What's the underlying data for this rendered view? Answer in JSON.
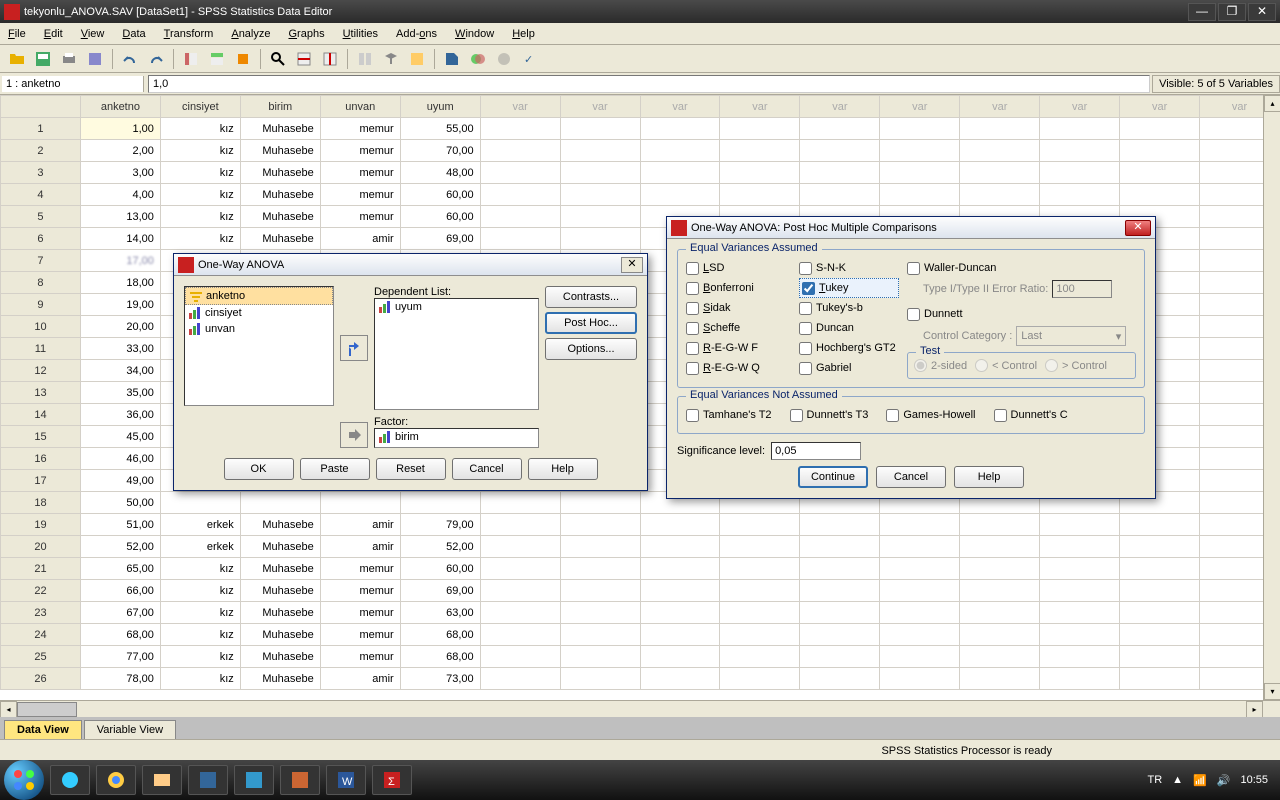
{
  "window": {
    "title": "tekyonlu_ANOVA.SAV [DataSet1] - SPSS Statistics Data Editor"
  },
  "menus": [
    "File",
    "Edit",
    "View",
    "Data",
    "Transform",
    "Analyze",
    "Graphs",
    "Utilities",
    "Add-ons",
    "Window",
    "Help"
  ],
  "cellbar": {
    "ref": "1 : anketno",
    "val": "1,0",
    "visible": "Visible: 5 of 5 Variables"
  },
  "columns": [
    "anketno",
    "cinsiyet",
    "birim",
    "unvan",
    "uyum"
  ],
  "varcol": "var",
  "rows": [
    {
      "n": 1,
      "c": [
        "1,00",
        "kız",
        "Muhasebe",
        "memur",
        "55,00"
      ]
    },
    {
      "n": 2,
      "c": [
        "2,00",
        "kız",
        "Muhasebe",
        "memur",
        "70,00"
      ]
    },
    {
      "n": 3,
      "c": [
        "3,00",
        "kız",
        "Muhasebe",
        "memur",
        "48,00"
      ]
    },
    {
      "n": 4,
      "c": [
        "4,00",
        "kız",
        "Muhasebe",
        "memur",
        "60,00"
      ]
    },
    {
      "n": 5,
      "c": [
        "13,00",
        "kız",
        "Muhasebe",
        "memur",
        "60,00"
      ]
    },
    {
      "n": 6,
      "c": [
        "14,00",
        "kız",
        "Muhasebe",
        "amir",
        "69,00"
      ]
    },
    {
      "n": 7,
      "c": [
        "17,00",
        "",
        "",
        "",
        ""
      ],
      "blur": true
    },
    {
      "n": 8,
      "c": [
        "18,00",
        "",
        "",
        "",
        ""
      ]
    },
    {
      "n": 9,
      "c": [
        "19,00",
        "",
        "",
        "",
        ""
      ]
    },
    {
      "n": 10,
      "c": [
        "20,00",
        "",
        "",
        "",
        ""
      ]
    },
    {
      "n": 11,
      "c": [
        "33,00",
        "",
        "",
        "",
        ""
      ]
    },
    {
      "n": 12,
      "c": [
        "34,00",
        "",
        "",
        "",
        ""
      ]
    },
    {
      "n": 13,
      "c": [
        "35,00",
        "",
        "",
        "",
        ""
      ]
    },
    {
      "n": 14,
      "c": [
        "36,00",
        "",
        "",
        "",
        ""
      ]
    },
    {
      "n": 15,
      "c": [
        "45,00",
        "",
        "",
        "",
        ""
      ]
    },
    {
      "n": 16,
      "c": [
        "46,00",
        "",
        "",
        "",
        ""
      ]
    },
    {
      "n": 17,
      "c": [
        "49,00",
        "",
        "",
        "",
        ""
      ]
    },
    {
      "n": 18,
      "c": [
        "50,00",
        "",
        "",
        "",
        ""
      ]
    },
    {
      "n": 19,
      "c": [
        "51,00",
        "erkek",
        "Muhasebe",
        "amir",
        "79,00"
      ]
    },
    {
      "n": 20,
      "c": [
        "52,00",
        "erkek",
        "Muhasebe",
        "amir",
        "52,00"
      ]
    },
    {
      "n": 21,
      "c": [
        "65,00",
        "kız",
        "Muhasebe",
        "memur",
        "60,00"
      ]
    },
    {
      "n": 22,
      "c": [
        "66,00",
        "kız",
        "Muhasebe",
        "memur",
        "69,00"
      ]
    },
    {
      "n": 23,
      "c": [
        "67,00",
        "kız",
        "Muhasebe",
        "memur",
        "63,00"
      ]
    },
    {
      "n": 24,
      "c": [
        "68,00",
        "kız",
        "Muhasebe",
        "memur",
        "68,00"
      ]
    },
    {
      "n": 25,
      "c": [
        "77,00",
        "kız",
        "Muhasebe",
        "memur",
        "68,00"
      ]
    },
    {
      "n": 26,
      "c": [
        "78,00",
        "kız",
        "Muhasebe",
        "amir",
        "73,00"
      ]
    }
  ],
  "tabs": {
    "data": "Data View",
    "var": "Variable View"
  },
  "status": "SPSS Statistics Processor is ready",
  "dialog1": {
    "title": "One-Way ANOVA",
    "source": [
      "anketno",
      "cinsiyet",
      "unvan"
    ],
    "dep_label": "Dependent List:",
    "dep": [
      "uyum"
    ],
    "factor_label": "Factor:",
    "factor": "birim",
    "btns": {
      "contrasts": "Contrasts...",
      "posthoc": "Post Hoc...",
      "options": "Options..."
    },
    "footer": {
      "ok": "OK",
      "paste": "Paste",
      "reset": "Reset",
      "cancel": "Cancel",
      "help": "Help"
    }
  },
  "dialog2": {
    "title": "One-Way ANOVA: Post Hoc Multiple Comparisons",
    "eq_legend": "Equal Variances Assumed",
    "neq_legend": "Equal Variances Not Assumed",
    "col1": [
      "LSD",
      "Bonferroni",
      "Sidak",
      "Scheffe",
      "R-E-G-W F",
      "R-E-G-W Q"
    ],
    "col2": [
      "S-N-K",
      "Tukey",
      "Tukey's-b",
      "Duncan",
      "Hochberg's GT2",
      "Gabriel"
    ],
    "col3": {
      "waller": "Waller-Duncan",
      "ratio_lbl": "Type I/Type II Error Ratio:",
      "ratio": "100",
      "dunnett": "Dunnett",
      "cat_lbl": "Control Category :",
      "cat": "Last",
      "test_lbl": "Test",
      "r1": "2-sided",
      "r2": "< Control",
      "r3": "> Control"
    },
    "neq": [
      "Tamhane's T2",
      "Dunnett's T3",
      "Games-Howell",
      "Dunnett's C"
    ],
    "sig_lbl": "Significance level:",
    "sig": "0,05",
    "footer": {
      "cont": "Continue",
      "cancel": "Cancel",
      "help": "Help"
    }
  },
  "tray": {
    "lang": "TR",
    "time": "10:55"
  }
}
